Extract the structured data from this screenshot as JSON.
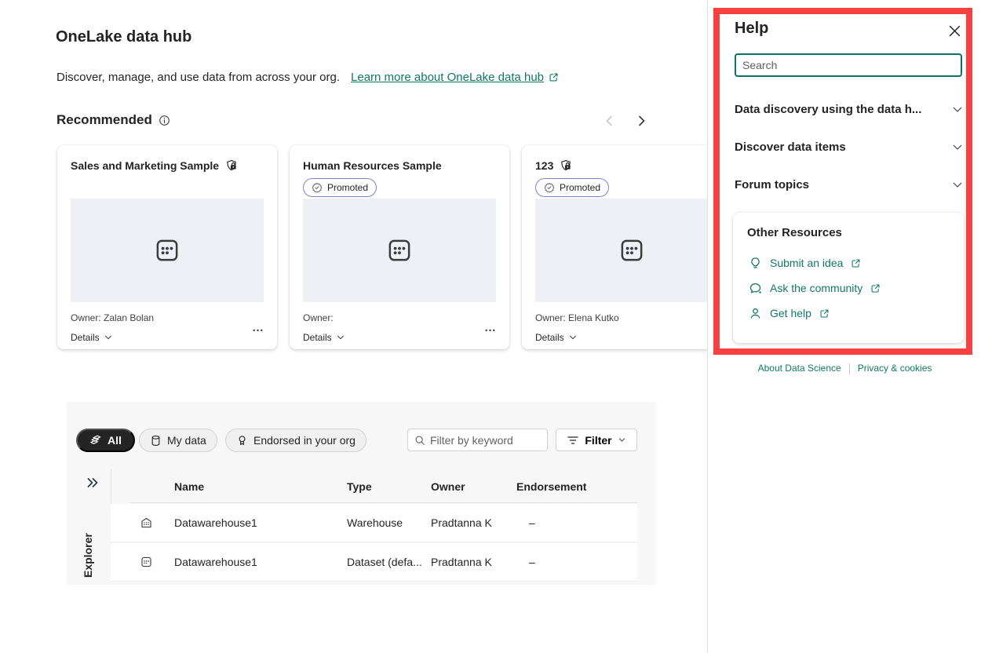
{
  "page": {
    "title": "OneLake data hub",
    "subtitle": "Discover, manage, and use data from across your org.",
    "learn_more_label": "Learn more about OneLake data hub"
  },
  "recommended": {
    "title": "Recommended",
    "cards": [
      {
        "title": "Sales and Marketing Sample",
        "owner": "Owner: Zalan Bolan",
        "details_label": "Details",
        "more_label": "…"
      },
      {
        "title": "Human Resources Sample",
        "badge": "Promoted",
        "owner": "Owner:",
        "details_label": "Details",
        "more_label": "…"
      },
      {
        "title": "123",
        "badge": "Promoted",
        "owner": "Owner: Elena Kutko",
        "details_label": "Details"
      }
    ]
  },
  "filters": {
    "all_label": "All",
    "my_data_label": "My data",
    "endorsed_label": "Endorsed in your org",
    "keyword_placeholder": "Filter by keyword",
    "filter_label": "Filter"
  },
  "explorer": {
    "label": "Explorer"
  },
  "table": {
    "columns": {
      "name": "Name",
      "type": "Type",
      "owner": "Owner",
      "endorsement": "Endorsement"
    },
    "rows": [
      {
        "icon": "warehouse-icon",
        "name": "Datawarehouse1",
        "type": "Warehouse",
        "owner": "Pradtanna K",
        "endorsement": "–"
      },
      {
        "icon": "dataset-icon",
        "name": "Datawarehouse1",
        "type": "Dataset (defa...",
        "owner": "Pradtanna K",
        "endorsement": "–"
      }
    ]
  },
  "help_panel": {
    "title": "Help",
    "search_placeholder": "Search",
    "sections": [
      "Data discovery using the data h...",
      "Discover data items",
      "Forum topics"
    ],
    "other_resources": {
      "title": "Other Resources",
      "links": [
        {
          "icon": "lightbulb-icon",
          "label": "Submit an idea"
        },
        {
          "icon": "chat-icon",
          "label": "Ask the community"
        },
        {
          "icon": "person-icon",
          "label": "Get help"
        }
      ]
    },
    "footer_links": [
      "About Data Science",
      "Privacy & cookies"
    ]
  },
  "colors": {
    "accent_teal": "#117865",
    "annotation_red": "#f84040"
  }
}
